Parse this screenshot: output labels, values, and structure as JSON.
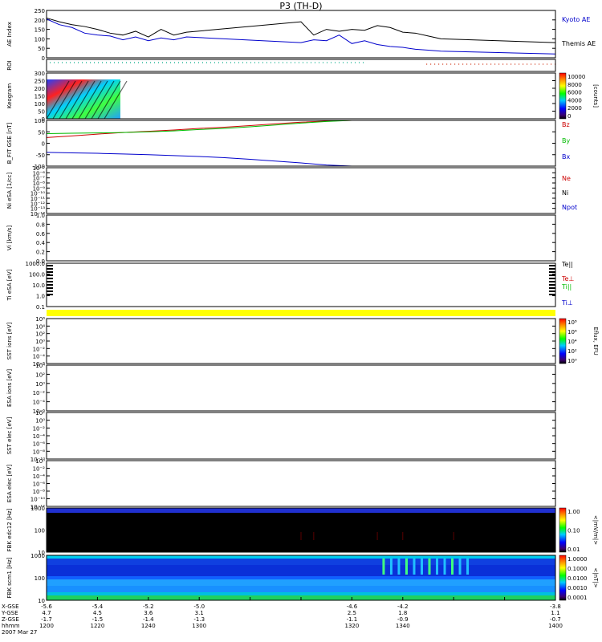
{
  "title": "P3 (TH-D)",
  "date": "2007 Mar 27",
  "footer_rows": [
    {
      "label": "X-GSE",
      "values": [
        "-5.6",
        "-5.4",
        "-5.2",
        "-5.0",
        "-4.6",
        "-4.2",
        "-3.8"
      ]
    },
    {
      "label": "Y-GSE",
      "values": [
        "4.7",
        "4.5",
        "3.6",
        "3.1",
        "2.5",
        "1.8",
        "1.1"
      ]
    },
    {
      "label": "Z-GSE",
      "values": [
        "-1.7",
        "-1.5",
        "-1.4",
        "-1.3",
        "-1.1",
        "-0.9",
        "-0.7"
      ]
    },
    {
      "label": "hhmm",
      "values": [
        "1200",
        "1220",
        "1240",
        "1300",
        "1320",
        "1340",
        "1400"
      ]
    }
  ],
  "chart_data": [
    {
      "type": "line",
      "ylabel": "AE Index",
      "ylim": [
        0,
        250
      ],
      "yticks": [
        "250",
        "200",
        "150",
        "100",
        "50",
        "0"
      ],
      "x": [
        1200,
        1205,
        1210,
        1215,
        1220,
        1225,
        1230,
        1235,
        1240,
        1245,
        1250,
        1255,
        1300,
        1305,
        1310,
        1315,
        1320,
        1325,
        1330,
        1335,
        1340,
        1345,
        1350,
        1355,
        1400
      ],
      "series": [
        {
          "name": "Kyoto AE",
          "color": "#0000cc",
          "values": [
            205,
            175,
            160,
            130,
            120,
            115,
            95,
            110,
            90,
            105,
            95,
            110,
            80,
            95,
            90,
            120,
            75,
            90,
            70,
            60,
            55,
            45,
            40,
            35,
            20
          ]
        },
        {
          "name": "Themis AE",
          "color": "#000000",
          "values": [
            210,
            190,
            175,
            165,
            150,
            130,
            120,
            140,
            110,
            150,
            120,
            135,
            190,
            120,
            150,
            140,
            150,
            145,
            170,
            160,
            135,
            130,
            115,
            100,
            80
          ]
        }
      ]
    },
    {
      "type": "scatter",
      "ylabel": "ROI",
      "series": [
        {
          "color": "#00aa88",
          "x_range": [
            1200,
            1325
          ]
        },
        {
          "color": "#cc2200",
          "x_range": [
            1348,
            1400
          ]
        }
      ]
    },
    {
      "type": "heatmap",
      "ylabel": "Keogram",
      "yticks": [
        "300",
        "250",
        "200",
        "150",
        "100",
        "50",
        "0"
      ],
      "x_range": [
        1200,
        1229
      ],
      "colorbar": {
        "label": "[counts]",
        "ticks": [
          "10000",
          "8000",
          "6000",
          "4000",
          "2000",
          "0"
        ]
      }
    },
    {
      "type": "line",
      "ylabel": "B_FIT GSE [nT]",
      "ylim": [
        -100,
        100
      ],
      "yticks": [
        "100",
        "50",
        "0",
        "-50",
        "-100"
      ],
      "x": [
        1200,
        1210,
        1220,
        1230,
        1240,
        1250,
        1260,
        1270,
        1280,
        1290,
        1300,
        1310,
        1320
      ],
      "series": [
        {
          "name": "Bz",
          "color": "#cc0000",
          "values": [
            25,
            32,
            40,
            47,
            52,
            58,
            65,
            70,
            77,
            85,
            92,
            97,
            100
          ]
        },
        {
          "name": "By",
          "color": "#00bb00",
          "values": [
            42,
            44,
            45,
            47,
            50,
            54,
            60,
            65,
            72,
            80,
            88,
            95,
            100
          ]
        },
        {
          "name": "Bx",
          "color": "#0000cc",
          "values": [
            -40,
            -42,
            -44,
            -47,
            -50,
            -54,
            -58,
            -63,
            -70,
            -78,
            -86,
            -95,
            -100
          ]
        }
      ]
    },
    {
      "type": "line",
      "ylabel": "Ni eSA [1/cc]",
      "yticks": [
        "10^-5",
        "10^-6",
        "10^-7",
        "10^-8",
        "10^-9",
        "10^-10",
        "10^-11",
        "10^-12",
        "10^-13",
        "10^-14"
      ],
      "legend": [
        {
          "name": "Ne",
          "color": "#cc0000"
        },
        {
          "name": "Ni",
          "color": "#000000"
        },
        {
          "name": "Npot",
          "color": "#0000cc"
        }
      ]
    },
    {
      "type": "line",
      "ylabel": "Vi [km/s]",
      "yticks": [
        "1.0",
        "0.8",
        "0.6",
        "0.4",
        "0.2",
        "0.0"
      ]
    },
    {
      "type": "line",
      "ylabel": "Ti eSA [eV]",
      "yticks": [
        "1000.0",
        "100.0",
        "10.0",
        "1.0",
        "0.1"
      ],
      "legend": [
        {
          "name": "Te||",
          "color": "#000000"
        },
        {
          "name": "Te⊥",
          "color": "#cc0000"
        },
        {
          "name": "Ti||",
          "color": "#00bb00"
        },
        {
          "name": "Ti⊥",
          "color": "#0000cc"
        }
      ]
    },
    {
      "type": "heatmap",
      "ylabel": "SST ions [eV]",
      "yticks": [
        "10^6",
        "10^4",
        "10^2",
        "10^0",
        "10^-2",
        "10^-4",
        "10^-6"
      ],
      "colorbar": {
        "label": "Eflux, EFU",
        "ticks": [
          "10^8",
          "10^6",
          "10^4",
          "10^2",
          "10^0"
        ]
      }
    },
    {
      "type": "heatmap",
      "ylabel": "ESA ions [eV]",
      "yticks": [
        "10^4",
        "10^2",
        "10^0",
        "10^-2",
        "10^-4",
        "10^-6"
      ]
    },
    {
      "type": "heatmap",
      "ylabel": "SST elec [eV]",
      "yticks": [
        "10^2",
        "10^0",
        "10^-2",
        "10^-4",
        "10^-6",
        "10^-8",
        "10^-10"
      ]
    },
    {
      "type": "heatmap",
      "ylabel": "ESA elec [eV]",
      "yticks": [
        "10^0",
        "10^-2",
        "10^-4",
        "10^-6",
        "10^-8",
        "10^-10",
        "10^-12"
      ]
    },
    {
      "type": "heatmap",
      "ylabel": "FBK edc12 [Hz]",
      "yticks": [
        "1000",
        "100",
        "10"
      ],
      "colorbar": {
        "label": "<|mV/m|>",
        "ticks": [
          "1.00",
          "0.10",
          "0.01"
        ]
      }
    },
    {
      "type": "heatmap",
      "ylabel": "FBK scm1 [Hz]",
      "yticks": [
        "1000",
        "100",
        "10"
      ],
      "colorbar": {
        "label": "<|nT|>",
        "ticks": [
          "1.0000",
          "0.1000",
          "0.0100",
          "0.0010",
          "0.0001"
        ]
      }
    }
  ]
}
